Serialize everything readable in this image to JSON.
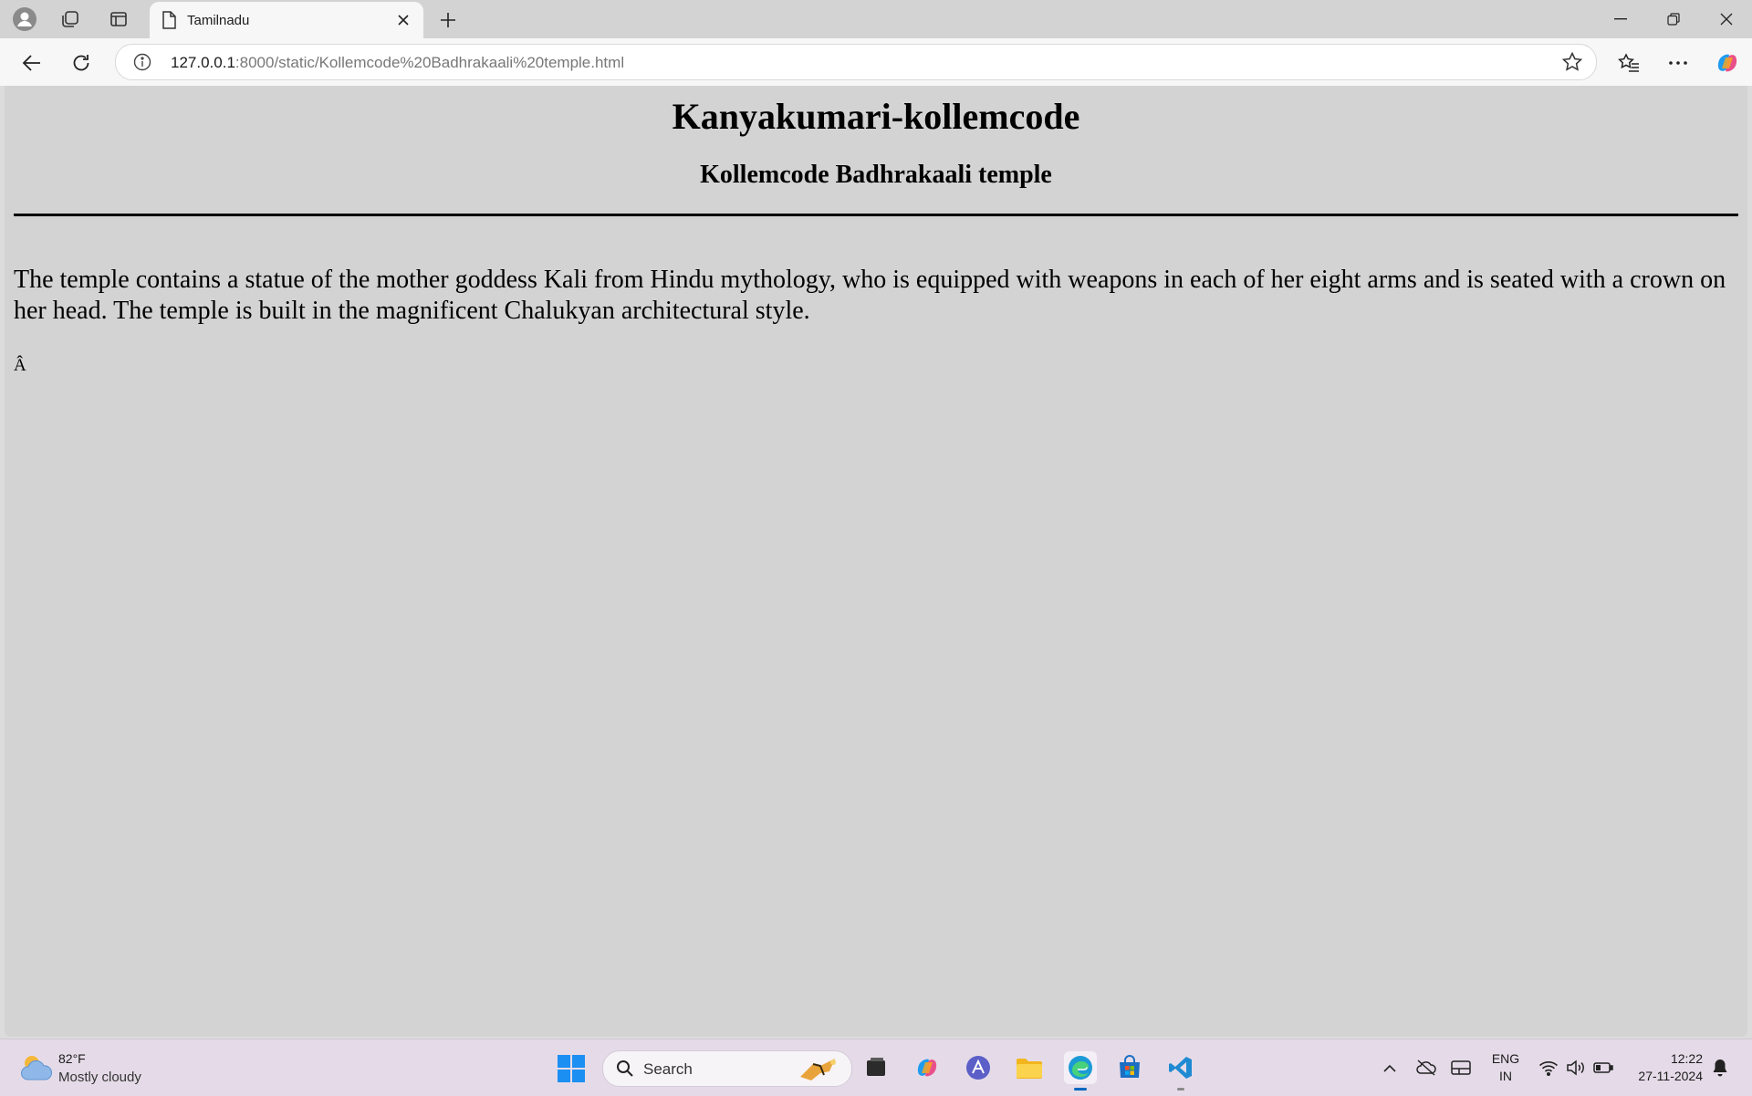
{
  "browser": {
    "tab": {
      "title": "Tamilnadu"
    },
    "address": {
      "host": "127.0.0.1",
      "path": ":8000/static/Kollemcode%20Badhrakaali%20temple.html"
    }
  },
  "page": {
    "heading": "Kanyakumari-kollemcode",
    "subheading": "Kollemcode Badhrakaali temple",
    "paragraph": "The temple contains a statue of the mother goddess Kali from Hindu mythology, who is equipped with weapons in each of her eight arms and is seated with a crown on her head. The temple is built in the magnificent Chalukyan architectural style.",
    "stray_char": "Â"
  },
  "taskbar": {
    "weather": {
      "temp": "82°F",
      "desc": "Mostly cloudy"
    },
    "search_label": "Search",
    "lang": {
      "line1": "ENG",
      "line2": "IN"
    },
    "clock": {
      "time": "12:22",
      "date": "27-11-2024"
    }
  },
  "colors": {
    "page_bg": "#d3d3d3",
    "accent": "#0067c0"
  }
}
